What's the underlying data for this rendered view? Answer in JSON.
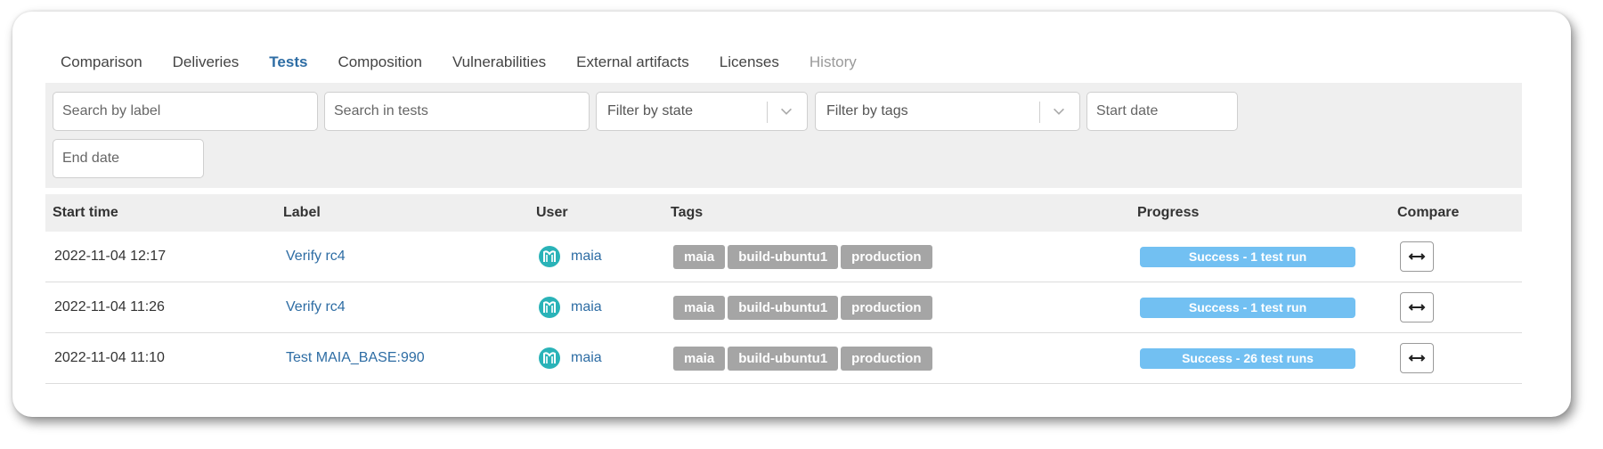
{
  "tabs": [
    {
      "label": "Comparison",
      "state": "normal"
    },
    {
      "label": "Deliveries",
      "state": "normal"
    },
    {
      "label": "Tests",
      "state": "active"
    },
    {
      "label": "Composition",
      "state": "normal"
    },
    {
      "label": "Vulnerabilities",
      "state": "normal"
    },
    {
      "label": "External artifacts",
      "state": "normal"
    },
    {
      "label": "Licenses",
      "state": "normal"
    },
    {
      "label": "History",
      "state": "disabled"
    }
  ],
  "filters": {
    "search_label_placeholder": "Search by label",
    "search_tests_placeholder": "Search in tests",
    "state_placeholder": "Filter by state",
    "tags_placeholder": "Filter by tags",
    "start_date_placeholder": "Start date",
    "end_date_placeholder": "End date"
  },
  "table": {
    "headers": {
      "start_time": "Start time",
      "label": "Label",
      "user": "User",
      "tags": "Tags",
      "progress": "Progress",
      "compare": "Compare"
    },
    "rows": [
      {
        "start_time": "2022-11-04 12:17",
        "label": "Verify rc4",
        "user": "maia",
        "tags": [
          "maia",
          "build-ubuntu1",
          "production"
        ],
        "progress": "Success - 1 test run"
      },
      {
        "start_time": "2022-11-04 11:26",
        "label": "Verify rc4",
        "user": "maia",
        "tags": [
          "maia",
          "build-ubuntu1",
          "production"
        ],
        "progress": "Success - 1 test run"
      },
      {
        "start_time": "2022-11-04 11:10",
        "label": "Test MAIA_BASE:990",
        "user": "maia",
        "tags": [
          "maia",
          "build-ubuntu1",
          "production"
        ],
        "progress": "Success - 26 test runs"
      }
    ]
  },
  "icons": {
    "avatar": "user-avatar-icon",
    "compare": "double-arrow-icon",
    "select": "chevron-down-icon"
  },
  "colors": {
    "accent": "#2e6da4",
    "tag_bg": "#a5a5a5",
    "progress_success": "#72c0f2"
  }
}
